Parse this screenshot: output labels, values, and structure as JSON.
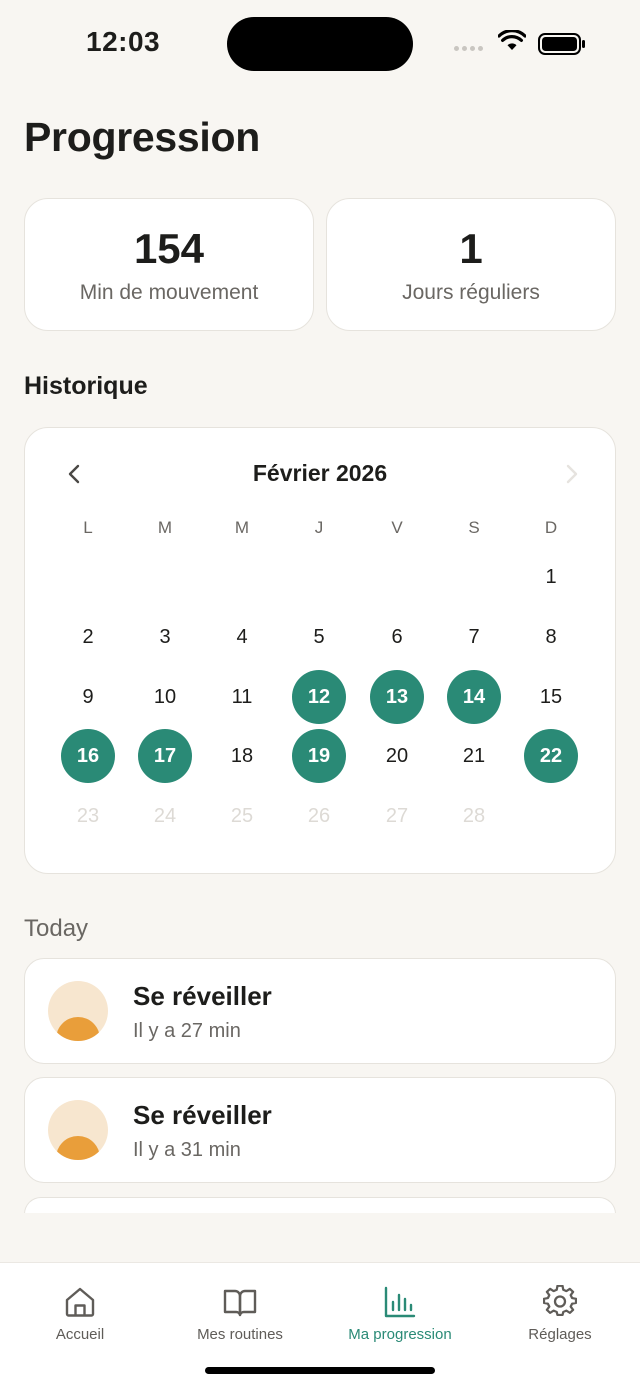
{
  "status_bar": {
    "time": "12:03"
  },
  "page": {
    "title": "Progression"
  },
  "stats": [
    {
      "value": "154",
      "label": "Min de mouvement"
    },
    {
      "value": "1",
      "label": "Jours réguliers"
    }
  ],
  "history": {
    "title": "Historique",
    "month_label": "Février 2026",
    "weekdays": [
      "L",
      "M",
      "M",
      "J",
      "V",
      "S",
      "D"
    ],
    "days": [
      {
        "n": "1",
        "state": "normal"
      },
      {
        "n": "2",
        "state": "normal"
      },
      {
        "n": "3",
        "state": "normal"
      },
      {
        "n": "4",
        "state": "normal"
      },
      {
        "n": "5",
        "state": "normal"
      },
      {
        "n": "6",
        "state": "normal"
      },
      {
        "n": "7",
        "state": "normal"
      },
      {
        "n": "8",
        "state": "normal"
      },
      {
        "n": "9",
        "state": "normal"
      },
      {
        "n": "10",
        "state": "normal"
      },
      {
        "n": "11",
        "state": "normal"
      },
      {
        "n": "12",
        "state": "active"
      },
      {
        "n": "13",
        "state": "active"
      },
      {
        "n": "14",
        "state": "active"
      },
      {
        "n": "15",
        "state": "normal"
      },
      {
        "n": "16",
        "state": "active"
      },
      {
        "n": "17",
        "state": "active"
      },
      {
        "n": "18",
        "state": "normal"
      },
      {
        "n": "19",
        "state": "active"
      },
      {
        "n": "20",
        "state": "normal"
      },
      {
        "n": "21",
        "state": "normal"
      },
      {
        "n": "22",
        "state": "active"
      },
      {
        "n": "23",
        "state": "disabled"
      },
      {
        "n": "24",
        "state": "disabled"
      },
      {
        "n": "25",
        "state": "disabled"
      },
      {
        "n": "26",
        "state": "disabled"
      },
      {
        "n": "27",
        "state": "disabled"
      },
      {
        "n": "28",
        "state": "disabled"
      }
    ],
    "first_weekday_index": 6,
    "next_enabled": false
  },
  "today": {
    "title": "Today",
    "items": [
      {
        "title": "Se réveiller",
        "time": "Il y a 27 min",
        "icon": "sunrise-icon"
      },
      {
        "title": "Se réveiller",
        "time": "Il y a 31 min",
        "icon": "sunrise-icon"
      }
    ]
  },
  "tabs": [
    {
      "label": "Accueil",
      "icon": "home-icon",
      "active": false
    },
    {
      "label": "Mes routines",
      "icon": "book-icon",
      "active": false
    },
    {
      "label": "Ma progression",
      "icon": "bar-chart-icon",
      "active": true
    },
    {
      "label": "Réglages",
      "icon": "gear-icon",
      "active": false
    }
  ],
  "colors": {
    "accent": "#2a8a76",
    "background": "#f8f6f2",
    "sunrise_light": "#f7e6cf",
    "sunrise_dark": "#e99e3a"
  }
}
